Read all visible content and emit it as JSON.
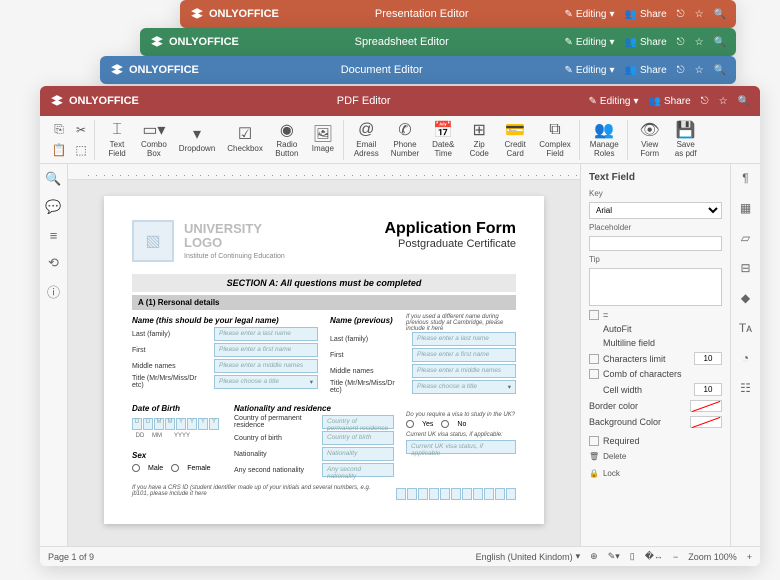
{
  "brand": "ONLYOFFICE",
  "windows": {
    "w1": {
      "title": "Presentation Editor",
      "editing": "Editing",
      "share": "Share"
    },
    "w2": {
      "title": "Spreadsheet Editor",
      "editing": "Editing",
      "share": "Share"
    },
    "w3": {
      "title": "Document Editor",
      "editing": "Editing",
      "share": "Share"
    },
    "w4": {
      "title": "PDF Editor",
      "editing": "Editing",
      "share": "Share"
    }
  },
  "toolbar": [
    {
      "name": "text-field",
      "label": "Text\nField"
    },
    {
      "name": "combo-box",
      "label": "Combo\nBox"
    },
    {
      "name": "dropdown",
      "label": "Dropdown"
    },
    {
      "name": "checkbox",
      "label": "Checkbox"
    },
    {
      "name": "radio-button",
      "label": "Radio\nButton"
    },
    {
      "name": "image",
      "label": "Image"
    },
    {
      "name": "email",
      "label": "Email\nAdress"
    },
    {
      "name": "phone",
      "label": "Phone\nNumber"
    },
    {
      "name": "date-time",
      "label": "Date&\nTime"
    },
    {
      "name": "zip",
      "label": "Zip\nCode"
    },
    {
      "name": "credit-card",
      "label": "Credit\nCard"
    },
    {
      "name": "complex",
      "label": "Complex\nField"
    },
    {
      "name": "manage-roles",
      "label": "Manage\nRoles"
    },
    {
      "name": "view-form",
      "label": "View\nForm"
    },
    {
      "name": "save-pdf",
      "label": "Save\nas pdf"
    }
  ],
  "document": {
    "uni_logo_line1": "UNIVERSITY",
    "uni_logo_line2": "LOGO",
    "uni_subtitle": "Institute of Continuing Education",
    "form_title": "Application Form",
    "form_subtitle": "Postgraduate Certificate",
    "section_a": "SECTION A: All questions must be completed",
    "a1_header": "A (1) Rersonal details",
    "name_legal": "Name (this should be your legal name)",
    "name_prev": "Name (previous)",
    "name_prev_note": "If you used a different name during previous study at Cambridge, please include it here",
    "last": "Last (family)",
    "first": "First",
    "middle": "Middle names",
    "title_field": "Title (Mr/Mrs/Miss/Dr etc)",
    "ph_last": "Please enter a last name",
    "ph_first": "Please enter a first name",
    "ph_middle": "Please enter a middle names",
    "ph_title": "Please choose a title",
    "dob": "Date of Birth",
    "dob_cells": [
      "D",
      "D",
      "M",
      "M",
      "Y",
      "Y",
      "Y",
      "Y"
    ],
    "dob_fmt": [
      "DD",
      "MM",
      "YYYY"
    ],
    "sex": "Sex",
    "male": "Male",
    "female": "Female",
    "nat_header": "Nationality and residence",
    "perm_res": "Country of permanent residence",
    "ph_perm_res": "Country of permanent residence",
    "cob": "Country of birth",
    "ph_cob": "Country of birth",
    "nationality": "Nationality",
    "ph_nationality": "Nationality",
    "second_nat": "Any second nationality",
    "ph_second_nat": "Any second nationality",
    "visa_q": "Do you require a visa to study in the UK?",
    "yes": "Yes",
    "no": "No",
    "visa_status": "Current UK visa status, if applicable:",
    "ph_visa_status": "Current UK visa status, if applicable",
    "crs_note": "If you have a CRS ID (student identifier made up of your initials and several numbers, e.g. jb101, please include it here"
  },
  "panel": {
    "title": "Text Field",
    "key": "Key",
    "key_value": "Arial",
    "placeholder": "Placeholder",
    "tip": "Tip",
    "eq": "=",
    "autofit": "AutoFit",
    "multiline": "Multiline field",
    "char_limit": "Characters limit",
    "char_limit_val": "10",
    "comb": "Comb of characters",
    "cell_width": "Cell width",
    "cell_width_val": "10",
    "border": "Border color",
    "bg": "Background Color",
    "required": "Required",
    "delete": "Delete",
    "lock": "Lock"
  },
  "status": {
    "page": "Page 1 of 9",
    "lang": "English (United Kindom)",
    "zoom": "Zoom 100%"
  }
}
